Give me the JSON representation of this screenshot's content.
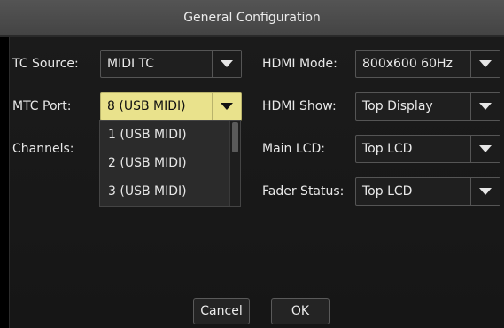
{
  "window": {
    "title": "General Configuration"
  },
  "form": {
    "tc_source": {
      "label": "TC Source:",
      "value": "MIDI TC"
    },
    "mtc_port": {
      "label": "MTC Port:",
      "value": "8 (USB MIDI)"
    },
    "channels": {
      "label": "Channels:"
    },
    "hdmi_mode": {
      "label": "HDMI Mode:",
      "value": "800x600 60Hz"
    },
    "hdmi_show": {
      "label": "HDMI Show:",
      "value": "Top Display"
    },
    "main_lcd": {
      "label": "Main LCD:",
      "value": "Top LCD"
    },
    "fader_status": {
      "label": "Fader Status:",
      "value": "Top LCD"
    }
  },
  "mtc_port_dropdown": {
    "options": [
      "1 (USB MIDI)",
      "2 (USB MIDI)",
      "3 (USB MIDI)"
    ]
  },
  "buttons": {
    "cancel": "Cancel",
    "ok": "OK"
  },
  "colors": {
    "highlight": "#e9e28c",
    "title_bar": "#4c4c4c",
    "panel": "#1b1b1b"
  },
  "icons": {
    "combo_arrow": "chevron-down-icon"
  }
}
